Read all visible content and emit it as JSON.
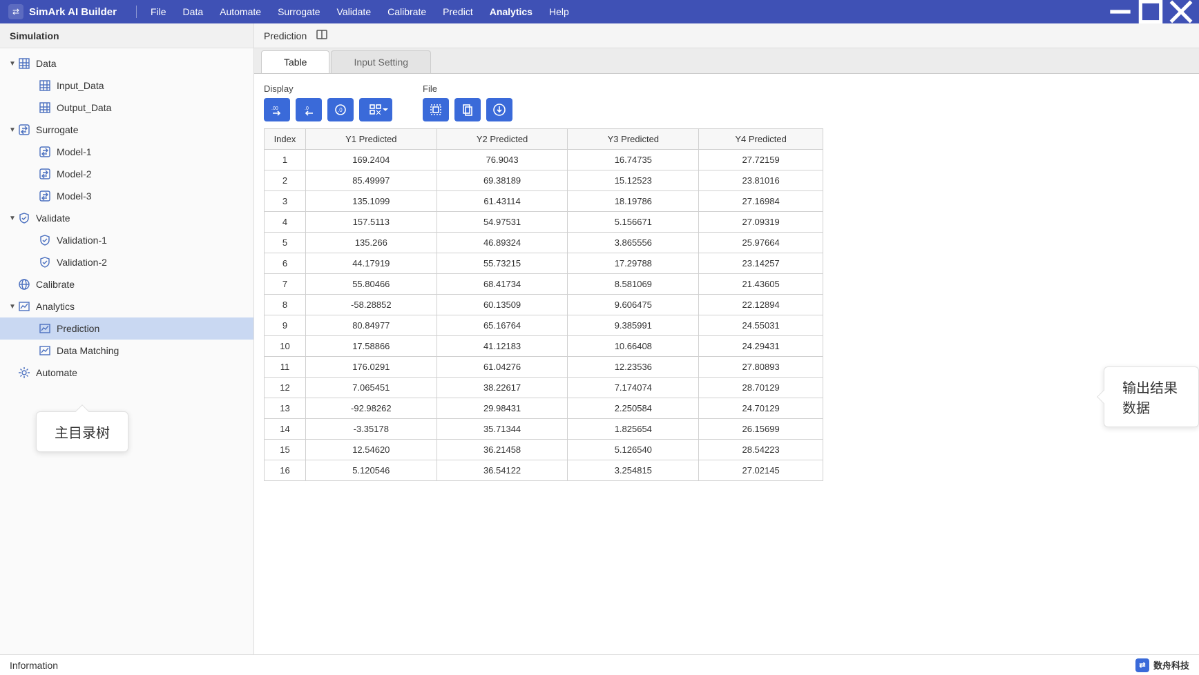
{
  "app": {
    "title": "SimArk AI Builder"
  },
  "menu": [
    "File",
    "Data",
    "Automate",
    "Surrogate",
    "Validate",
    "Calibrate",
    "Predict",
    "Analytics",
    "Help"
  ],
  "menu_active": "Analytics",
  "sidebar": {
    "header": "Simulation",
    "tree": [
      {
        "id": "data",
        "label": "Data",
        "icon": "grid",
        "level": 0,
        "exp": true
      },
      {
        "id": "input_data",
        "label": "Input_Data",
        "icon": "grid",
        "level": 1
      },
      {
        "id": "output_data",
        "label": "Output_Data",
        "icon": "grid",
        "level": 1
      },
      {
        "id": "surrogate",
        "label": "Surrogate",
        "icon": "swap",
        "level": 0,
        "exp": true
      },
      {
        "id": "model1",
        "label": "Model-1",
        "icon": "swap",
        "level": 1
      },
      {
        "id": "model2",
        "label": "Model-2",
        "icon": "swap",
        "level": 1
      },
      {
        "id": "model3",
        "label": "Model-3",
        "icon": "swap",
        "level": 1
      },
      {
        "id": "validate",
        "label": "Validate",
        "icon": "shield",
        "level": 0,
        "exp": true
      },
      {
        "id": "val1",
        "label": "Validation-1",
        "icon": "shield",
        "level": 1
      },
      {
        "id": "val2",
        "label": "Validation-2",
        "icon": "shield",
        "level": 1
      },
      {
        "id": "calibrate",
        "label": "Calibrate",
        "icon": "globe",
        "level": 0
      },
      {
        "id": "analytics",
        "label": "Analytics",
        "icon": "chart",
        "level": 0,
        "exp": true
      },
      {
        "id": "prediction",
        "label": "Prediction",
        "icon": "chart",
        "level": 1,
        "selected": true
      },
      {
        "id": "datamatch",
        "label": "Data Matching",
        "icon": "chart",
        "level": 1
      },
      {
        "id": "automate",
        "label": "Automate",
        "icon": "gear",
        "level": 0
      }
    ]
  },
  "predbar": {
    "title": "Prediction"
  },
  "tabs": [
    {
      "id": "table",
      "label": "Table",
      "active": true
    },
    {
      "id": "input",
      "label": "Input Setting",
      "active": false
    }
  ],
  "toolbar": {
    "display": {
      "label": "Display"
    },
    "file": {
      "label": "File"
    }
  },
  "table": {
    "headers": [
      "Index",
      "Y1 Predicted",
      "Y2 Predicted",
      "Y3 Predicted",
      "Y4 Predicted"
    ],
    "rows": [
      [
        "1",
        "169.2404",
        "76.9043",
        "16.74735",
        "27.72159"
      ],
      [
        "2",
        "85.49997",
        "69.38189",
        "15.12523",
        "23.81016"
      ],
      [
        "3",
        "135.1099",
        "61.43114",
        "18.19786",
        "27.16984"
      ],
      [
        "4",
        "157.5113",
        "54.97531",
        "5.156671",
        "27.09319"
      ],
      [
        "5",
        "135.266",
        "46.89324",
        "3.865556",
        "25.97664"
      ],
      [
        "6",
        "44.17919",
        "55.73215",
        "17.29788",
        "23.14257"
      ],
      [
        "7",
        "55.80466",
        "68.41734",
        "8.581069",
        "21.43605"
      ],
      [
        "8",
        "-58.28852",
        "60.13509",
        "9.606475",
        "22.12894"
      ],
      [
        "9",
        "80.84977",
        "65.16764",
        "9.385991",
        "24.55031"
      ],
      [
        "10",
        "17.58866",
        "41.12183",
        "10.66408",
        "24.29431"
      ],
      [
        "11",
        "176.0291",
        "61.04276",
        "12.23536",
        "27.80893"
      ],
      [
        "12",
        "7.065451",
        "38.22617",
        "7.174074",
        "28.70129"
      ],
      [
        "13",
        "-92.98262",
        "29.98431",
        "2.250584",
        "24.70129"
      ],
      [
        "14",
        "-3.35178",
        "35.71344",
        "1.825654",
        "26.15699"
      ],
      [
        "15",
        "12.54620",
        "36.21458",
        "5.126540",
        "28.54223"
      ],
      [
        "16",
        "5.120546",
        "36.54122",
        "3.254815",
        "27.02145"
      ]
    ]
  },
  "callouts": {
    "tree": "主目录树",
    "output": "输出结果数据"
  },
  "status": {
    "left": "Information",
    "brand": "数舟科技"
  }
}
